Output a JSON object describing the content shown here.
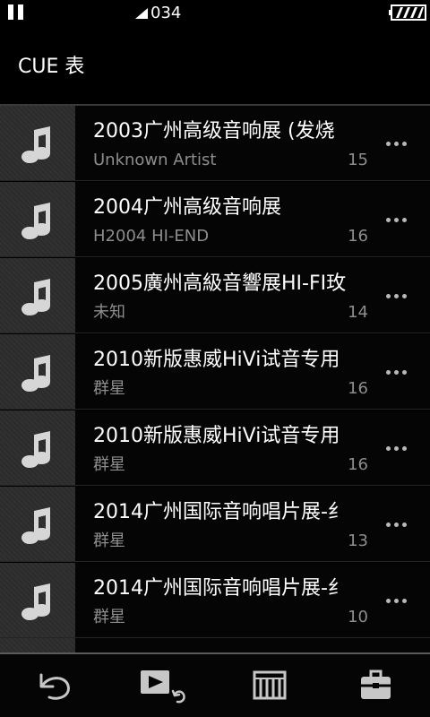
{
  "status_bar": {
    "time": "034",
    "pause_icon": "pause-icon",
    "signal_icon": "signal-icon",
    "battery_icon": "battery-icon"
  },
  "header": {
    "title": "CUE 表"
  },
  "list": {
    "item_icon": "music-note-icon",
    "more_icon": "more-icon",
    "items": [
      {
        "title": "2003广州高级音响展 (发烧",
        "artist": "Unknown Artist",
        "count": "15"
      },
      {
        "title": "2004广州高级音响展",
        "artist": "H2004 HI-END",
        "count": "16"
      },
      {
        "title": "2005廣州高級音響展HI-FI玫",
        "artist": "未知",
        "count": "14"
      },
      {
        "title": "2010新版惠威HiVi试音专用",
        "artist": "群星",
        "count": "16"
      },
      {
        "title": "2010新版惠威HiVi试音专用",
        "artist": "群星",
        "count": "16"
      },
      {
        "title": "2014广州国际音响唱片展-纟",
        "artist": "群星",
        "count": "13"
      },
      {
        "title": "2014广州国际音响唱片展-纟",
        "artist": "群星",
        "count": "10"
      }
    ]
  },
  "bottom_bar": {
    "back_icon": "back-icon",
    "now_playing_icon": "now-playing-icon",
    "queue_icon": "queue-icon",
    "toolbox_icon": "toolbox-icon"
  },
  "colors": {
    "background": "#000000",
    "primary_text": "#ffffff",
    "secondary_text": "#8d8d8d",
    "thumbnail": "#2f2f2f",
    "icon": "#bdbdbd"
  }
}
